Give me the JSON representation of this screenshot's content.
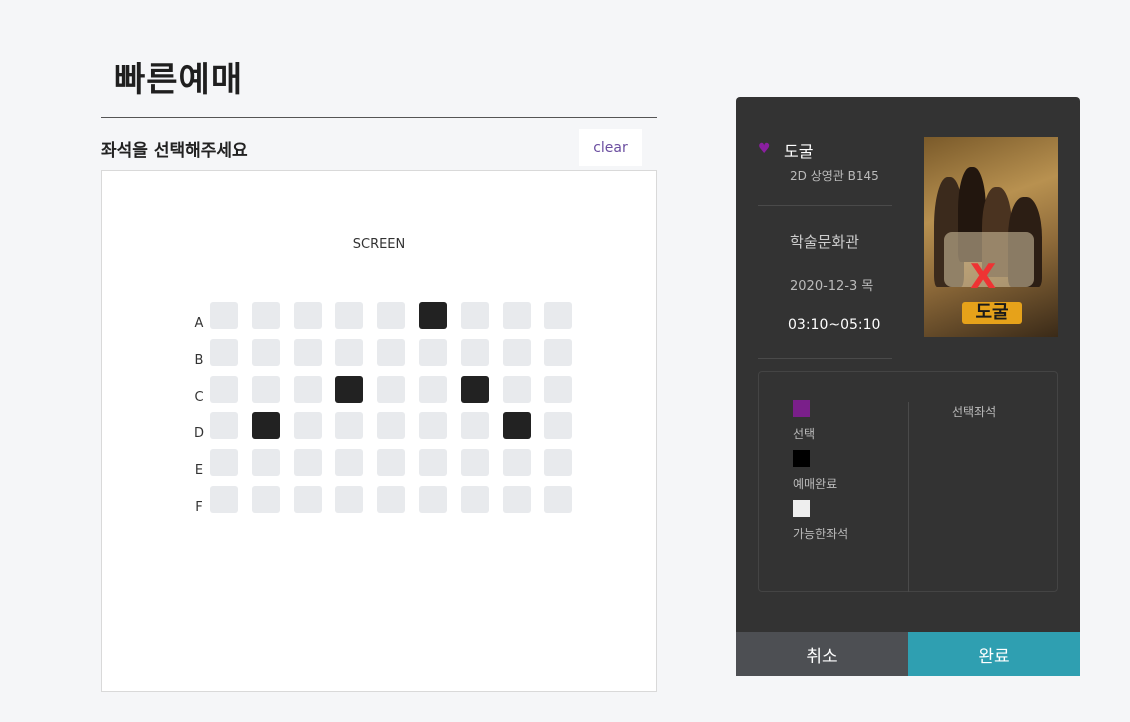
{
  "page": {
    "title": "빠른예매",
    "seat_heading": "좌석을 선택해주세요",
    "clear_label": "clear"
  },
  "seat_map": {
    "screen_label": "SCREEN",
    "rows": [
      {
        "label": "A",
        "seats": [
          "available",
          "available",
          "available",
          "available",
          "available",
          "sold",
          "available",
          "available",
          "available"
        ]
      },
      {
        "label": "B",
        "seats": [
          "available",
          "available",
          "available",
          "available",
          "available",
          "available",
          "available",
          "available",
          "available"
        ]
      },
      {
        "label": "C",
        "seats": [
          "available",
          "available",
          "available",
          "sold",
          "available",
          "available",
          "sold",
          "available",
          "available"
        ]
      },
      {
        "label": "D",
        "seats": [
          "available",
          "sold",
          "available",
          "available",
          "available",
          "available",
          "available",
          "sold",
          "available"
        ]
      },
      {
        "label": "E",
        "seats": [
          "available",
          "available",
          "available",
          "available",
          "available",
          "available",
          "available",
          "available",
          "available"
        ]
      },
      {
        "label": "F",
        "seats": [
          "available",
          "available",
          "available",
          "available",
          "available",
          "available",
          "available",
          "available",
          "available"
        ]
      }
    ]
  },
  "booking": {
    "movie_title": "도굴",
    "hall": "2D 상영관 B145",
    "theater": "학술문화관",
    "date": "2020-12-3 목",
    "time": "03:10~05:10",
    "poster": {
      "logo_text": "도굴"
    }
  },
  "legend": {
    "items": [
      {
        "label": "선택",
        "color": "#7a1f8a"
      },
      {
        "label": "예매완료",
        "color": "#000000"
      },
      {
        "label": "가능한좌석",
        "color": "#eeeeee"
      }
    ],
    "selected_heading": "선택좌석"
  },
  "actions": {
    "cancel_label": "취소",
    "confirm_label": "완료"
  },
  "colors": {
    "accent": "#2f9fb1",
    "selected": "#7a1f8a",
    "sold": "#222222",
    "available": "#e8eaed"
  }
}
